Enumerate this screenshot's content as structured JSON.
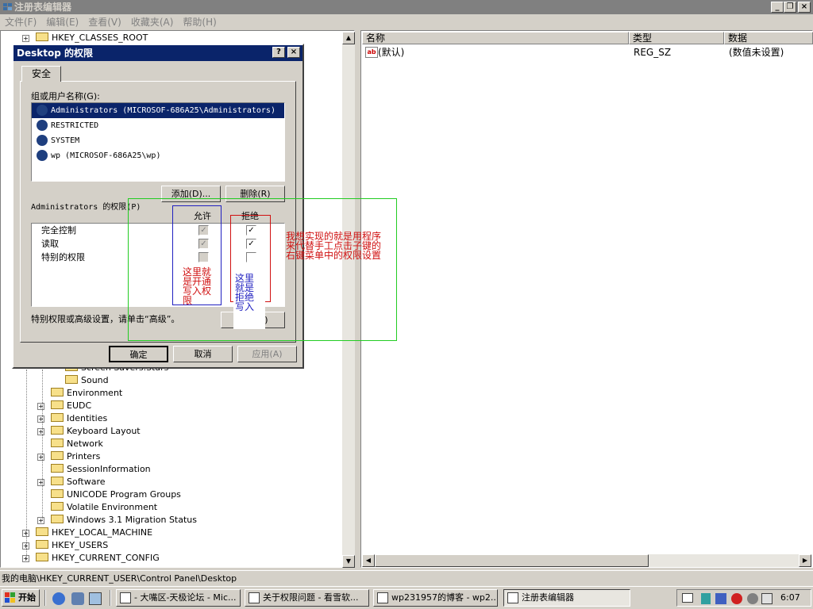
{
  "window": {
    "title": "注册表编辑器",
    "menus": [
      "文件(F)",
      "编辑(E)",
      "查看(V)",
      "收藏夹(A)",
      "帮助(H)"
    ]
  },
  "tree": {
    "top_items": [
      {
        "label": "HKEY_CLASSES_ROOT",
        "expander": "+"
      }
    ],
    "sub_items_partial": "Screen Savers.Stars",
    "sub_items": [
      {
        "label": "Sound",
        "expander": ""
      }
    ],
    "child_items": [
      {
        "label": "Environment",
        "expander": ""
      },
      {
        "label": "EUDC",
        "expander": "+"
      },
      {
        "label": "Identities",
        "expander": "+"
      },
      {
        "label": "Keyboard Layout",
        "expander": "+"
      },
      {
        "label": "Network",
        "expander": ""
      },
      {
        "label": "Printers",
        "expander": "+"
      },
      {
        "label": "SessionInformation",
        "expander": ""
      },
      {
        "label": "Software",
        "expander": "+"
      },
      {
        "label": "UNICODE Program Groups",
        "expander": ""
      },
      {
        "label": "Volatile Environment",
        "expander": ""
      },
      {
        "label": "Windows 3.1 Migration Status",
        "expander": "+"
      }
    ],
    "root_items": [
      {
        "label": "HKEY_LOCAL_MACHINE",
        "expander": "+"
      },
      {
        "label": "HKEY_USERS",
        "expander": "+"
      },
      {
        "label": "HKEY_CURRENT_CONFIG",
        "expander": "+"
      }
    ]
  },
  "list": {
    "columns": [
      "名称",
      "类型",
      "数据"
    ],
    "rows": [
      {
        "name": "(默认)",
        "type": "REG_SZ",
        "data": "(数值未设置)"
      }
    ]
  },
  "statusbar": {
    "path": "我的电脑\\HKEY_CURRENT_USER\\Control Panel\\Desktop"
  },
  "dialog": {
    "title": "Desktop 的权限",
    "help_btn": "?",
    "close_btn": "×",
    "tab": "安全",
    "group_label": "组或用户名称(G):",
    "users": [
      "Administrators (MICROSOF-686A25\\Administrators)",
      "RESTRICTED",
      "SYSTEM",
      "wp (MICROSOF-686A25\\wp)"
    ],
    "add_btn": "添加(D)...",
    "remove_btn": "删除(R)",
    "perm_label": "Administrators 的权限(P)",
    "allow_header": "允许",
    "deny_header": "拒绝",
    "permissions": [
      {
        "name": "完全控制",
        "allow": true,
        "deny": true
      },
      {
        "name": "读取",
        "allow": true,
        "deny": true
      },
      {
        "name": "特别的权限",
        "allow": false,
        "deny": false
      }
    ],
    "advanced_hint": "特别权限或高级设置，请单击“高级”。",
    "advanced_btn": "高级(V)",
    "ok_btn": "确定",
    "cancel_btn": "取消",
    "apply_btn": "应用(A)"
  },
  "annotations": {
    "main": "我想实现的就是用程序来代替手工点击子键的右键菜单中的权限设置",
    "allow_note": "这里就是开通写入权限",
    "deny_note": "这里就是拒绝写入"
  },
  "taskbar": {
    "start": "开始",
    "tasks": [
      "- 大嘴区-天极论坛 - Mic...",
      "关于权限问题 - 看雪软...",
      "wp231957的博客 - wp2...",
      "注册表编辑器"
    ],
    "clock": "6:07"
  },
  "colors": {
    "title_active": "#0a246a",
    "annotation_red": "#d01010",
    "annotation_green": "#22cc22",
    "annotation_blue": "#2020c0"
  }
}
